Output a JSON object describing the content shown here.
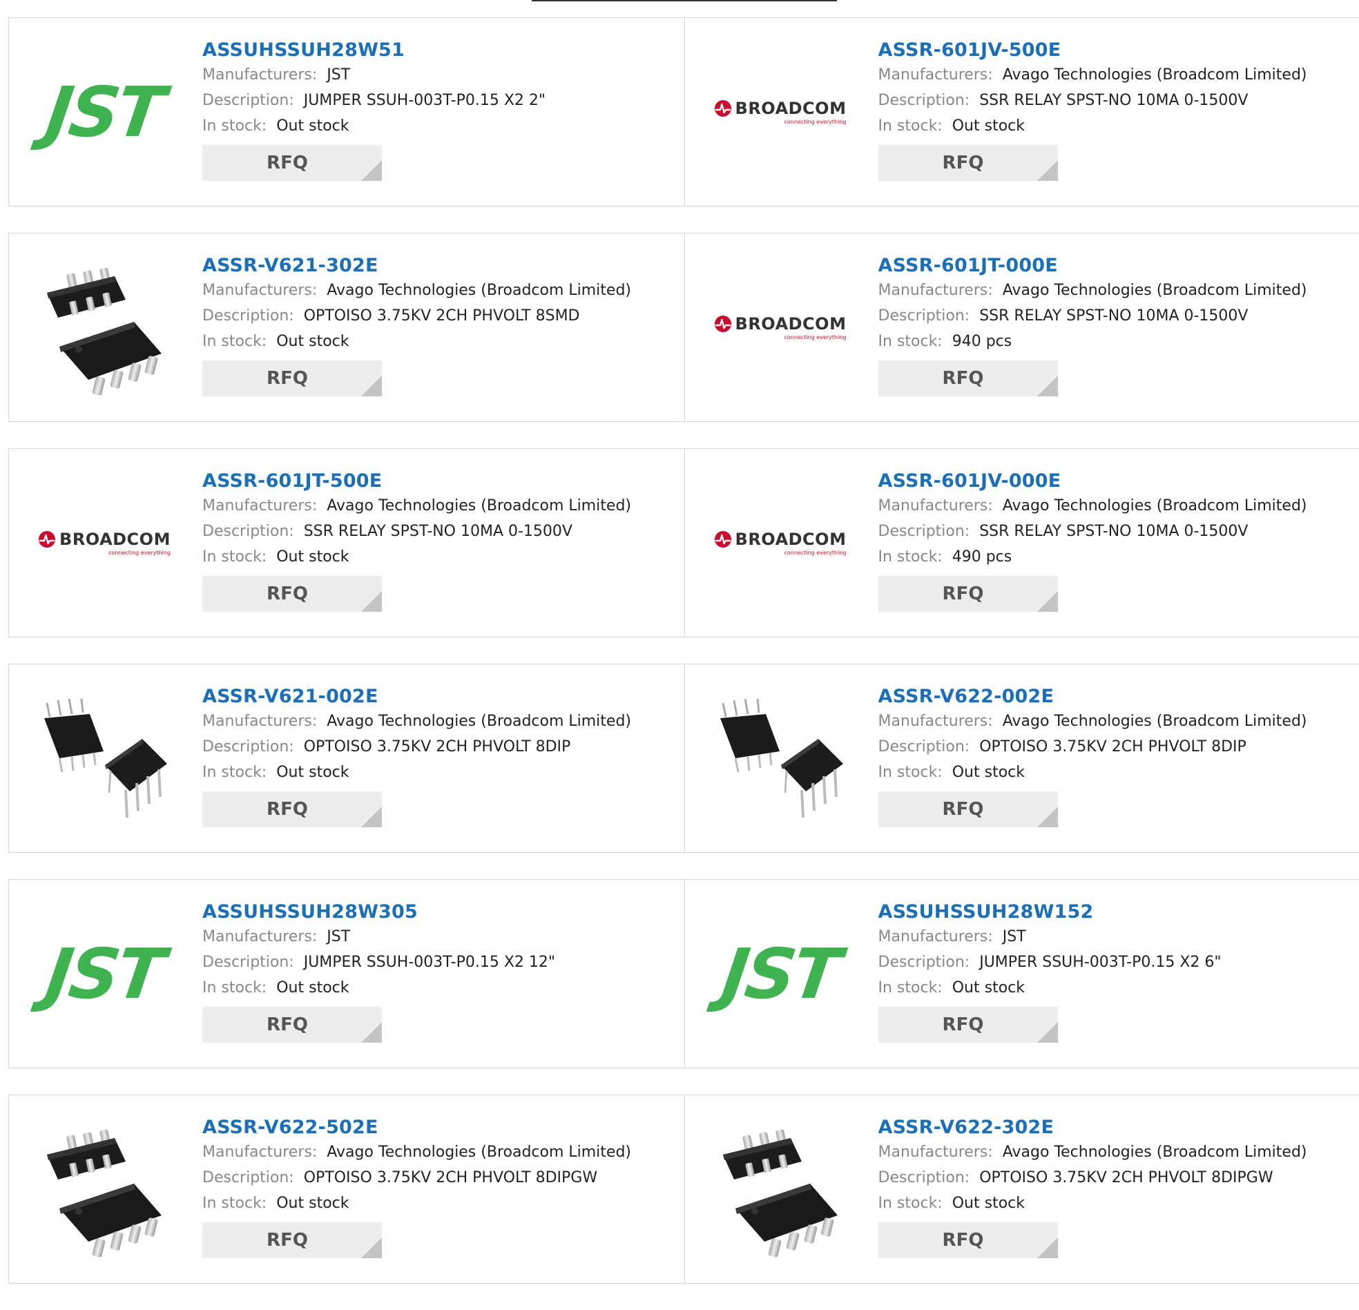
{
  "labels": {
    "manufacturers": "Manufacturers:",
    "description": "Description:",
    "in_stock": "In stock:",
    "rfq": "RFQ"
  },
  "logos": {
    "jst": "JST",
    "broadcom": "BROADCOM",
    "broadcom_tagline": "connecting everything"
  },
  "colors": {
    "part_number": "#1a6fb8",
    "jst_green": "#3fb34f",
    "broadcom_red": "#cc092f"
  },
  "products": [
    {
      "pn": "ASSUHSSUH28W51",
      "manufacturer": "JST",
      "description": "JUMPER SSUH-003T-P0.15 X2 2\"",
      "stock": "Out stock",
      "image": "jst-logo"
    },
    {
      "pn": "ASSR-601JV-500E",
      "manufacturer": "Avago Technologies (Broadcom Limited)",
      "description": "SSR RELAY SPST-NO 10MA 0-1500V",
      "stock": "Out stock",
      "image": "broadcom-logo"
    },
    {
      "pn": "ASSR-V621-302E",
      "manufacturer": "Avago Technologies (Broadcom Limited)",
      "description": "OPTOISO 3.75KV 2CH PHVOLT 8SMD",
      "stock": "Out stock",
      "image": "smd-chip"
    },
    {
      "pn": "ASSR-601JT-000E",
      "manufacturer": "Avago Technologies (Broadcom Limited)",
      "description": "SSR RELAY SPST-NO 10MA 0-1500V",
      "stock": "940 pcs",
      "image": "broadcom-logo"
    },
    {
      "pn": "ASSR-601JT-500E",
      "manufacturer": "Avago Technologies (Broadcom Limited)",
      "description": "SSR RELAY SPST-NO 10MA 0-1500V",
      "stock": "Out stock",
      "image": "broadcom-logo"
    },
    {
      "pn": "ASSR-601JV-000E",
      "manufacturer": "Avago Technologies (Broadcom Limited)",
      "description": "SSR RELAY SPST-NO 10MA 0-1500V",
      "stock": "490 pcs",
      "image": "broadcom-logo"
    },
    {
      "pn": "ASSR-V621-002E",
      "manufacturer": "Avago Technologies (Broadcom Limited)",
      "description": "OPTOISO 3.75KV 2CH PHVOLT 8DIP",
      "stock": "Out stock",
      "image": "dip-chip"
    },
    {
      "pn": "ASSR-V622-002E",
      "manufacturer": "Avago Technologies (Broadcom Limited)",
      "description": "OPTOISO 3.75KV 2CH PHVOLT 8DIP",
      "stock": "Out stock",
      "image": "dip-chip"
    },
    {
      "pn": "ASSUHSSUH28W305",
      "manufacturer": "JST",
      "description": "JUMPER SSUH-003T-P0.15 X2 12\"",
      "stock": "Out stock",
      "image": "jst-logo"
    },
    {
      "pn": "ASSUHSSUH28W152",
      "manufacturer": "JST",
      "description": "JUMPER SSUH-003T-P0.15 X2 6\"",
      "stock": "Out stock",
      "image": "jst-logo"
    },
    {
      "pn": "ASSR-V622-502E",
      "manufacturer": "Avago Technologies (Broadcom Limited)",
      "description": "OPTOISO 3.75KV 2CH PHVOLT 8DIPGW",
      "stock": "Out stock",
      "image": "smd-chip"
    },
    {
      "pn": "ASSR-V622-302E",
      "manufacturer": "Avago Technologies (Broadcom Limited)",
      "description": "OPTOISO 3.75KV 2CH PHVOLT 8DIPGW",
      "stock": "Out stock",
      "image": "smd-chip"
    }
  ]
}
